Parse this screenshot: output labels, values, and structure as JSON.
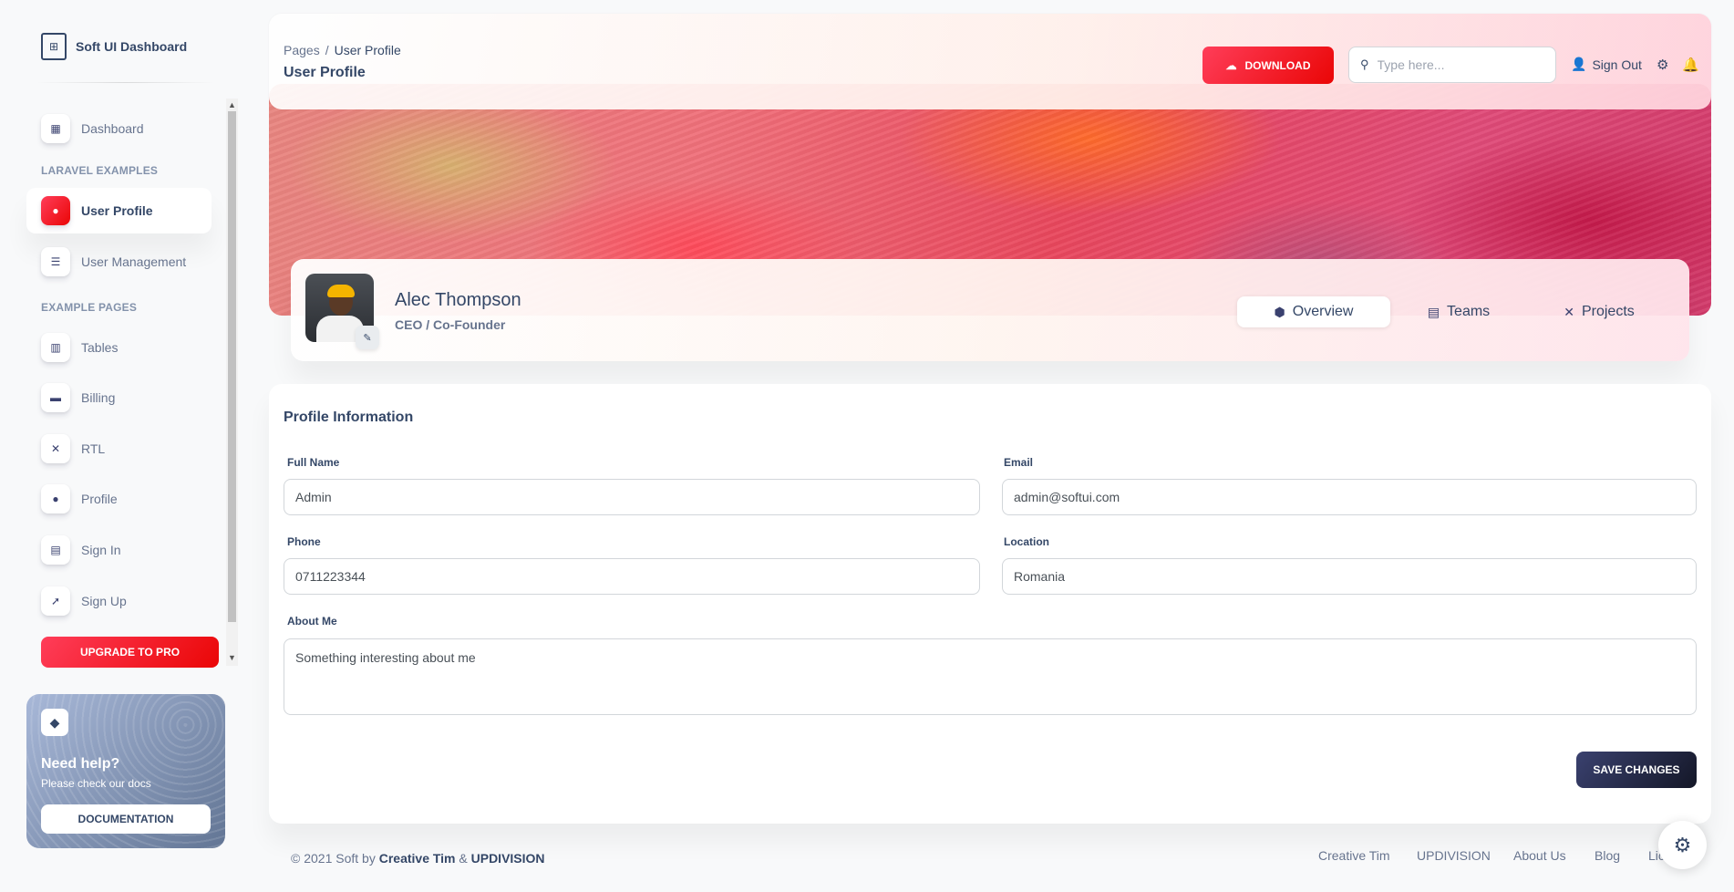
{
  "brand": {
    "title": "Soft UI Dashboard"
  },
  "sidebar": {
    "items": [
      {
        "label": "Dashboard",
        "icon": "shop-icon"
      },
      {
        "label": "User Profile",
        "icon": "user-icon",
        "active": true
      },
      {
        "label": "User Management",
        "icon": "list-icon"
      },
      {
        "label": "Tables",
        "icon": "office-icon"
      },
      {
        "label": "Billing",
        "icon": "credit-card-icon"
      },
      {
        "label": "RTL",
        "icon": "settings-icon"
      },
      {
        "label": "Profile",
        "icon": "customer-support-icon"
      },
      {
        "label": "Sign In",
        "icon": "document-icon"
      },
      {
        "label": "Sign Up",
        "icon": "spaceship-icon"
      }
    ],
    "sections": [
      "LARAVEL EXAMPLES",
      "EXAMPLE PAGES"
    ],
    "upgrade_label": "UPGRADE TO PRO"
  },
  "help": {
    "title": "Need help?",
    "subtitle": "Please check our docs",
    "button": "DOCUMENTATION"
  },
  "navbar": {
    "breadcrumb_root": "Pages",
    "breadcrumb_current": "User Profile",
    "page_title": "User Profile",
    "download_label": "DOWNLOAD",
    "search_placeholder": "Type here...",
    "signout_label": "Sign Out"
  },
  "profile": {
    "name": "Alec Thompson",
    "role": "CEO / Co-Founder",
    "tabs": [
      {
        "label": "Overview",
        "active": true
      },
      {
        "label": "Teams"
      },
      {
        "label": "Projects"
      }
    ]
  },
  "form": {
    "title": "Profile Information",
    "full_name_label": "Full Name",
    "full_name_value": "Admin",
    "email_label": "Email",
    "email_value": "admin@softui.com",
    "phone_label": "Phone",
    "phone_value": "0711223344",
    "location_label": "Location",
    "location_value": "Romania",
    "about_label": "About Me",
    "about_value": "Something interesting about me",
    "save_label": "SAVE CHANGES"
  },
  "footer": {
    "copyright": "© 2021 Soft by",
    "author1": "Creative Tim",
    "amp": "&",
    "author2": "UPDIVISION",
    "links": [
      "Creative Tim",
      "UPDIVISION",
      "About Us",
      "Blog",
      "Lic"
    ]
  },
  "colors": {
    "primary": "#ea0606",
    "primary_light": "#ff3d59",
    "dark": "#344767",
    "muted": "#67748e",
    "save_button": "#141727"
  }
}
